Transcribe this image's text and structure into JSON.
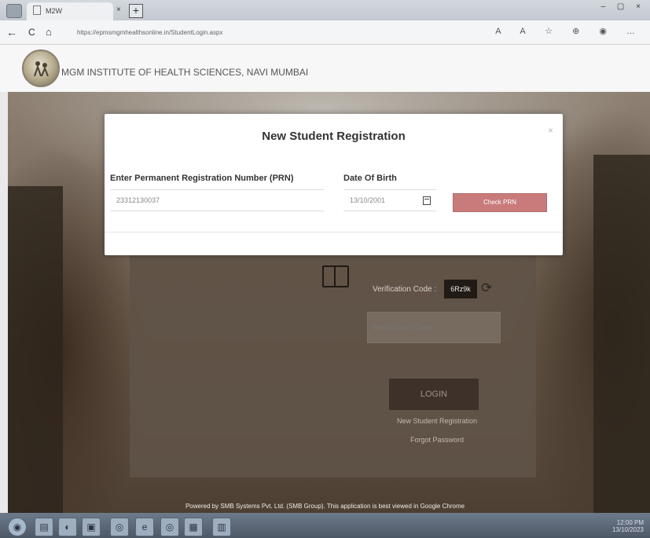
{
  "browser": {
    "tab_title": "M2W",
    "tab_close": "×",
    "new_tab": "+",
    "url": "https://epmsmgmhealthsonline.in/StudentLogin.aspx",
    "nav_back": "←",
    "nav_refresh": "C",
    "nav_home": "⌂",
    "window_controls": "– ▢ ×",
    "toolbar_icons": "A A ☆ ⊕ ◉ …"
  },
  "site": {
    "title": "MGM INSTITUTE OF HEALTH SCIENCES, NAVI MUMBAI"
  },
  "modal": {
    "title": "New Student Registration",
    "close": "×",
    "prn_label": "Enter Permanent Registration Number (PRN)",
    "prn_value": "23312130037",
    "dob_label": "Date Of Birth",
    "dob_value": "13/10/2001",
    "check_button": "Check PRN"
  },
  "login": {
    "verification_label": "Verification Code :",
    "captcha_value": "6Rz9k",
    "verification_placeholder": "Verification Code",
    "login_button": "LOGIN",
    "new_registration_link": "New Student Registration",
    "forgot_password_link": "Forgot Password"
  },
  "footer": {
    "text": "Powered by SMB Systems Pvt. Ltd. (SMB Group). This application is best viewed in Google Chrome"
  },
  "taskbar": {
    "items": [
      "◉",
      "▤",
      "◐",
      "▣",
      "◎",
      "e",
      "◎",
      "▦",
      "▥"
    ],
    "time": "12:00 PM",
    "date": "13/10/2023"
  }
}
